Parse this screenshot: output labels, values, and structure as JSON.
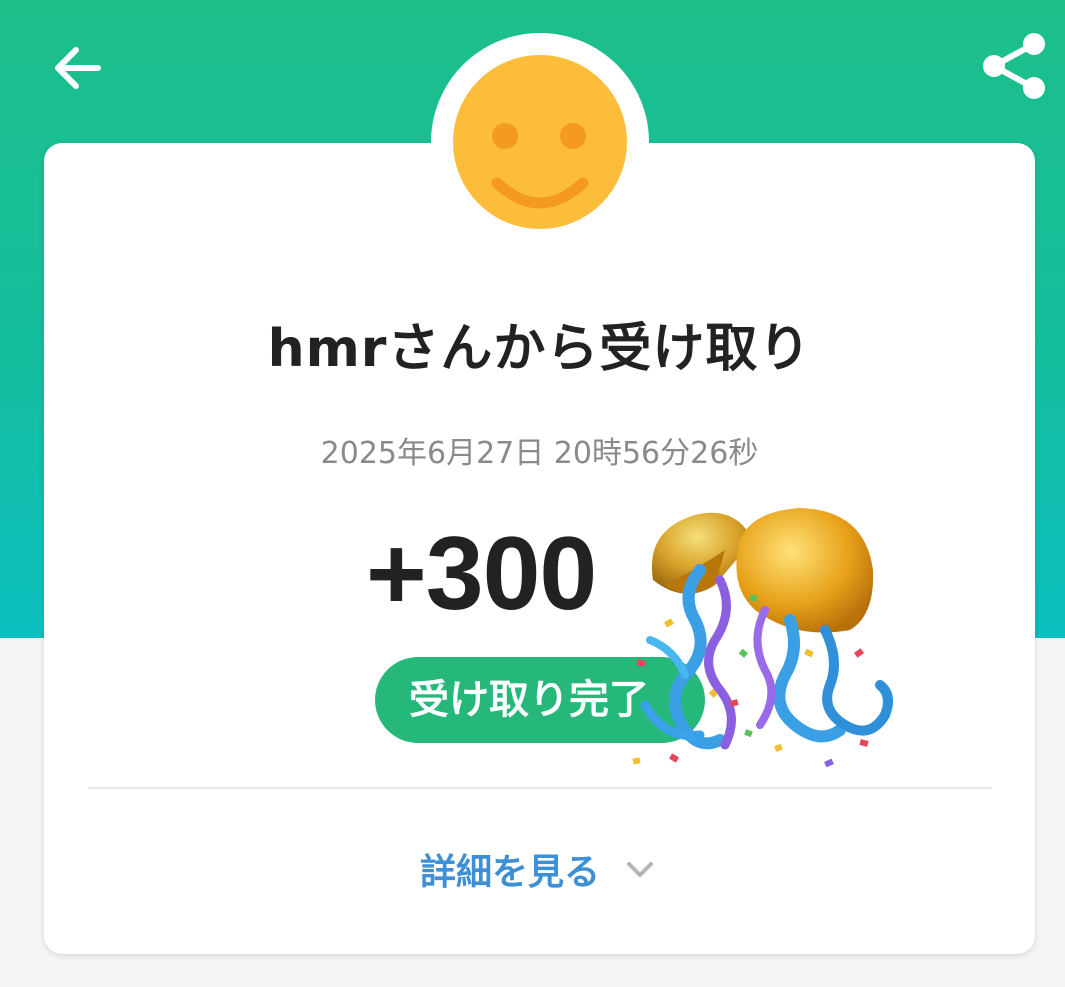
{
  "header": {
    "back_icon": "arrow-left-icon",
    "share_icon": "share-icon"
  },
  "card": {
    "avatar_icon": "smiley-face-icon",
    "title": "hmrさんから受け取り",
    "datetime": "2025年6月27日 20時56分26秒",
    "amount": "+300",
    "status": "受け取り完了",
    "celebration_icon": "party-popper-kusudama-icon",
    "details_label": "詳細を見る",
    "details_chevron": "chevron-down-icon"
  },
  "colors": {
    "header_green": "#1dbf8a",
    "header_teal": "#0bbfbf",
    "badge_green": "#25b87a",
    "link_blue": "#3d8fd6",
    "avatar_yellow": "#fbbd3a"
  }
}
